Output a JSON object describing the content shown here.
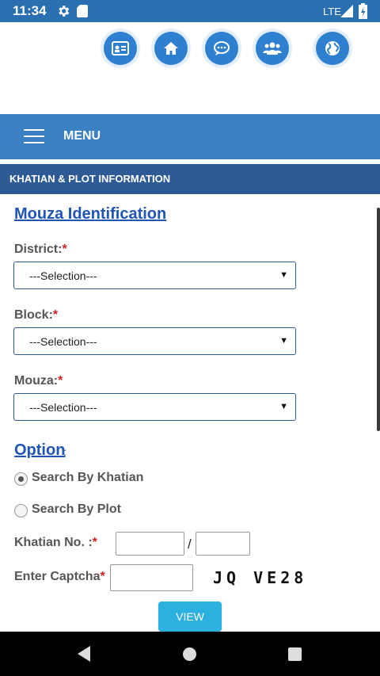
{
  "status_bar": {
    "time": "11:34",
    "network": "LTE",
    "icons": [
      "gear-icon",
      "sd-card-icon",
      "signal-icon",
      "battery-icon"
    ]
  },
  "top_icons": [
    "id-card-icon",
    "home-icon",
    "chat-icon",
    "people-icon",
    "globe-icon"
  ],
  "menu": {
    "label": "MENU"
  },
  "section": {
    "title": "KHATIAN & PLOT INFORMATION"
  },
  "form": {
    "mouza_heading": "Mouza Identification",
    "district": {
      "label": "District:",
      "required": "*",
      "selected": "---Selection---"
    },
    "block": {
      "label": "Block:",
      "required": "*",
      "selected": "---Selection---"
    },
    "mouza": {
      "label": "Mouza:",
      "required": "*",
      "selected": "---Selection---"
    },
    "option_heading": "Option",
    "option_colon": ":",
    "options": [
      {
        "label": "Search By Khatian",
        "checked": true
      },
      {
        "label": "Search By Plot",
        "checked": false
      }
    ],
    "khatian": {
      "label": "Khatian No. :",
      "required": "*",
      "separator": "/"
    },
    "captcha": {
      "label": "Enter Captcha",
      "required": "*",
      "code": "JQ VE28"
    },
    "view_button": "VIEW"
  },
  "colors": {
    "status_bar": "#2a6fb0",
    "menu_bar": "#3a80c2",
    "section_header": "#2e5b96",
    "link": "#1f55b5",
    "button": "#2bb0e0",
    "required": "#d21f1f"
  }
}
